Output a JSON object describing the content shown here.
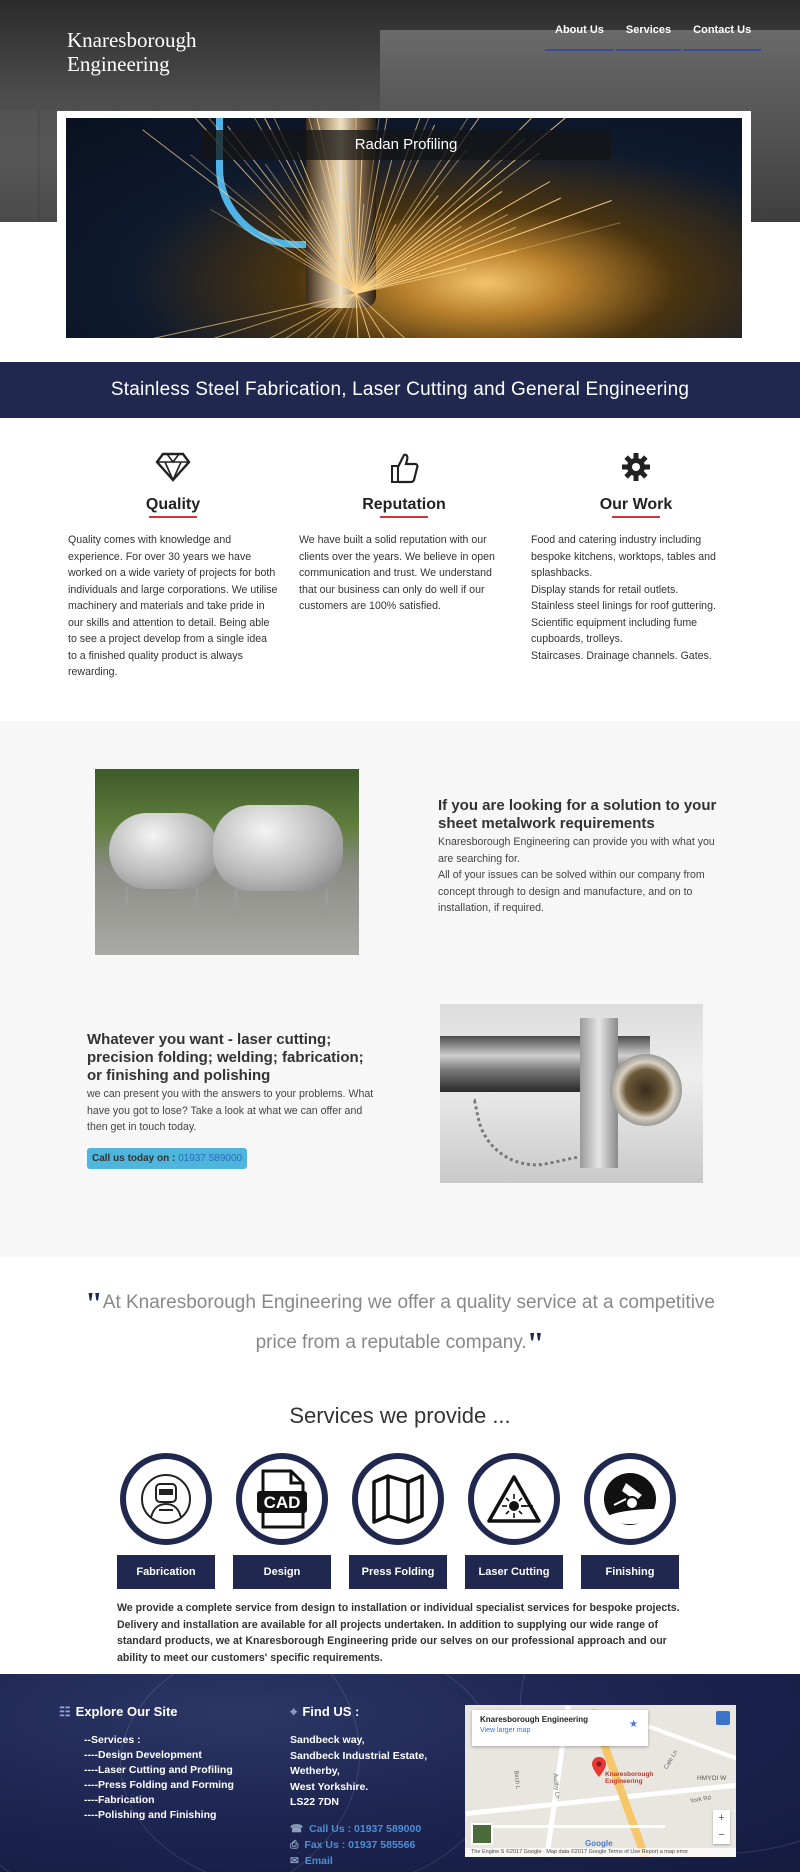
{
  "header": {
    "brand_line1": "Knaresborough",
    "brand_line2": "Engineering",
    "nav": [
      "About Us",
      "Services",
      "Contact Us"
    ]
  },
  "hero": {
    "caption": "Radan Profiling"
  },
  "tagline": "Stainless Steel Fabrication, Laser Cutting and General Engineering",
  "features": [
    {
      "icon": "diamond-icon",
      "title": "Quality",
      "paragraphs": [
        "Quality comes with knowledge and experience. For over 30 years we have worked on a wide variety of projects for both individuals and large corporations. We utilise machinery and materials and take pride in our skills and attention to detail. Being able to see a project develop from a single idea to a finished quality product is always rewarding."
      ]
    },
    {
      "icon": "thumbs-up-icon",
      "title": "Reputation",
      "paragraphs": [
        "We have built a solid reputation with our clients over the years. We believe in open communication and trust. We understand that our business can only do well if our customers are 100% satisfied."
      ]
    },
    {
      "icon": "gear-icon",
      "title": "Our Work",
      "paragraphs": [
        "Food and catering industry including bespoke kitchens, worktops, tables and splashbacks.",
        "Display stands for retail outlets.",
        "Stainless steel linings for roof guttering.",
        "Scientific equipment including fume cupboards, trolleys.",
        "Staircases. Drainage channels. Gates."
      ]
    }
  ],
  "section1": {
    "heading": "If you are looking for a solution to your sheet metalwork requirements",
    "paragraphs": [
      "Knaresborough Engineering can provide you with what you are searching for.",
      "All of your issues can be solved within our company from concept through to design and manufacture, and on to installation, if required."
    ]
  },
  "section2": {
    "heading": "Whatever you want - laser cutting; precision folding; welding; fabrication; or finishing and polishing",
    "text": "we can present you with the answers to your problems. What have you got to lose? Take a look at what we can offer and then get in touch today.",
    "call_label": "Call us today on : ",
    "call_number": "01937 589000"
  },
  "quote": {
    "open": "\"",
    "text": "At Knaresborough Engineering we offer a quality service at a competitive price from a reputable company.",
    "close": "\""
  },
  "services": {
    "heading": "Services we provide ...",
    "items": [
      {
        "label": "Fabrication",
        "icon": "welder-icon"
      },
      {
        "label": "Design",
        "icon": "cad-file-icon"
      },
      {
        "label": "Press Folding",
        "icon": "folded-map-icon"
      },
      {
        "label": "Laser Cutting",
        "icon": "laser-warning-icon"
      },
      {
        "label": "Finishing",
        "icon": "grinder-icon"
      }
    ],
    "text": "We provide a complete service from design to installation or individual specialist services for bespoke projects. Delivery and installation are available for all projects undertaken. In addition to supplying our wide range of standard products, we at Knaresborough Engineering pride our selves on our professional approach and our ability to meet our customers' specific requirements."
  },
  "footer": {
    "explore_heading": "Explore Our Site",
    "explore_links": [
      "--Services :",
      "----Design Development",
      "----Laser Cutting and Profiling",
      "----Press Folding and Forming",
      "----Fabrication",
      "----Polishing and Finishing"
    ],
    "find_heading": "Find US :",
    "address": [
      "Sandbeck way,",
      "Sandbeck Industrial Estate,",
      "Wetherby,",
      "West Yorkshire.",
      "LS22 7DN"
    ],
    "phone": "Call Us : 01937 589000",
    "fax": "Fax Us : 01937 585566",
    "email": "Email",
    "map": {
      "title": "Knaresborough Engineering",
      "link": "View larger map",
      "pin_label_1": "Knaresborough",
      "pin_label_2": "Engineering",
      "place": "HMYOI W",
      "street_1": "Birch L",
      "street_2": "Audby Ln",
      "street_3": "York Rd",
      "street_4": "Cale Ln",
      "street_5": "The Engine S",
      "google": "Google",
      "attribution": "©2017 Google · Map data ©2017 Google   Terms of Use   Report a map error"
    }
  },
  "colors": {
    "navy": "#20284f",
    "accent_red": "#d9323a",
    "button_blue": "#4eb6dc",
    "link_blue": "#4c8fd6"
  }
}
